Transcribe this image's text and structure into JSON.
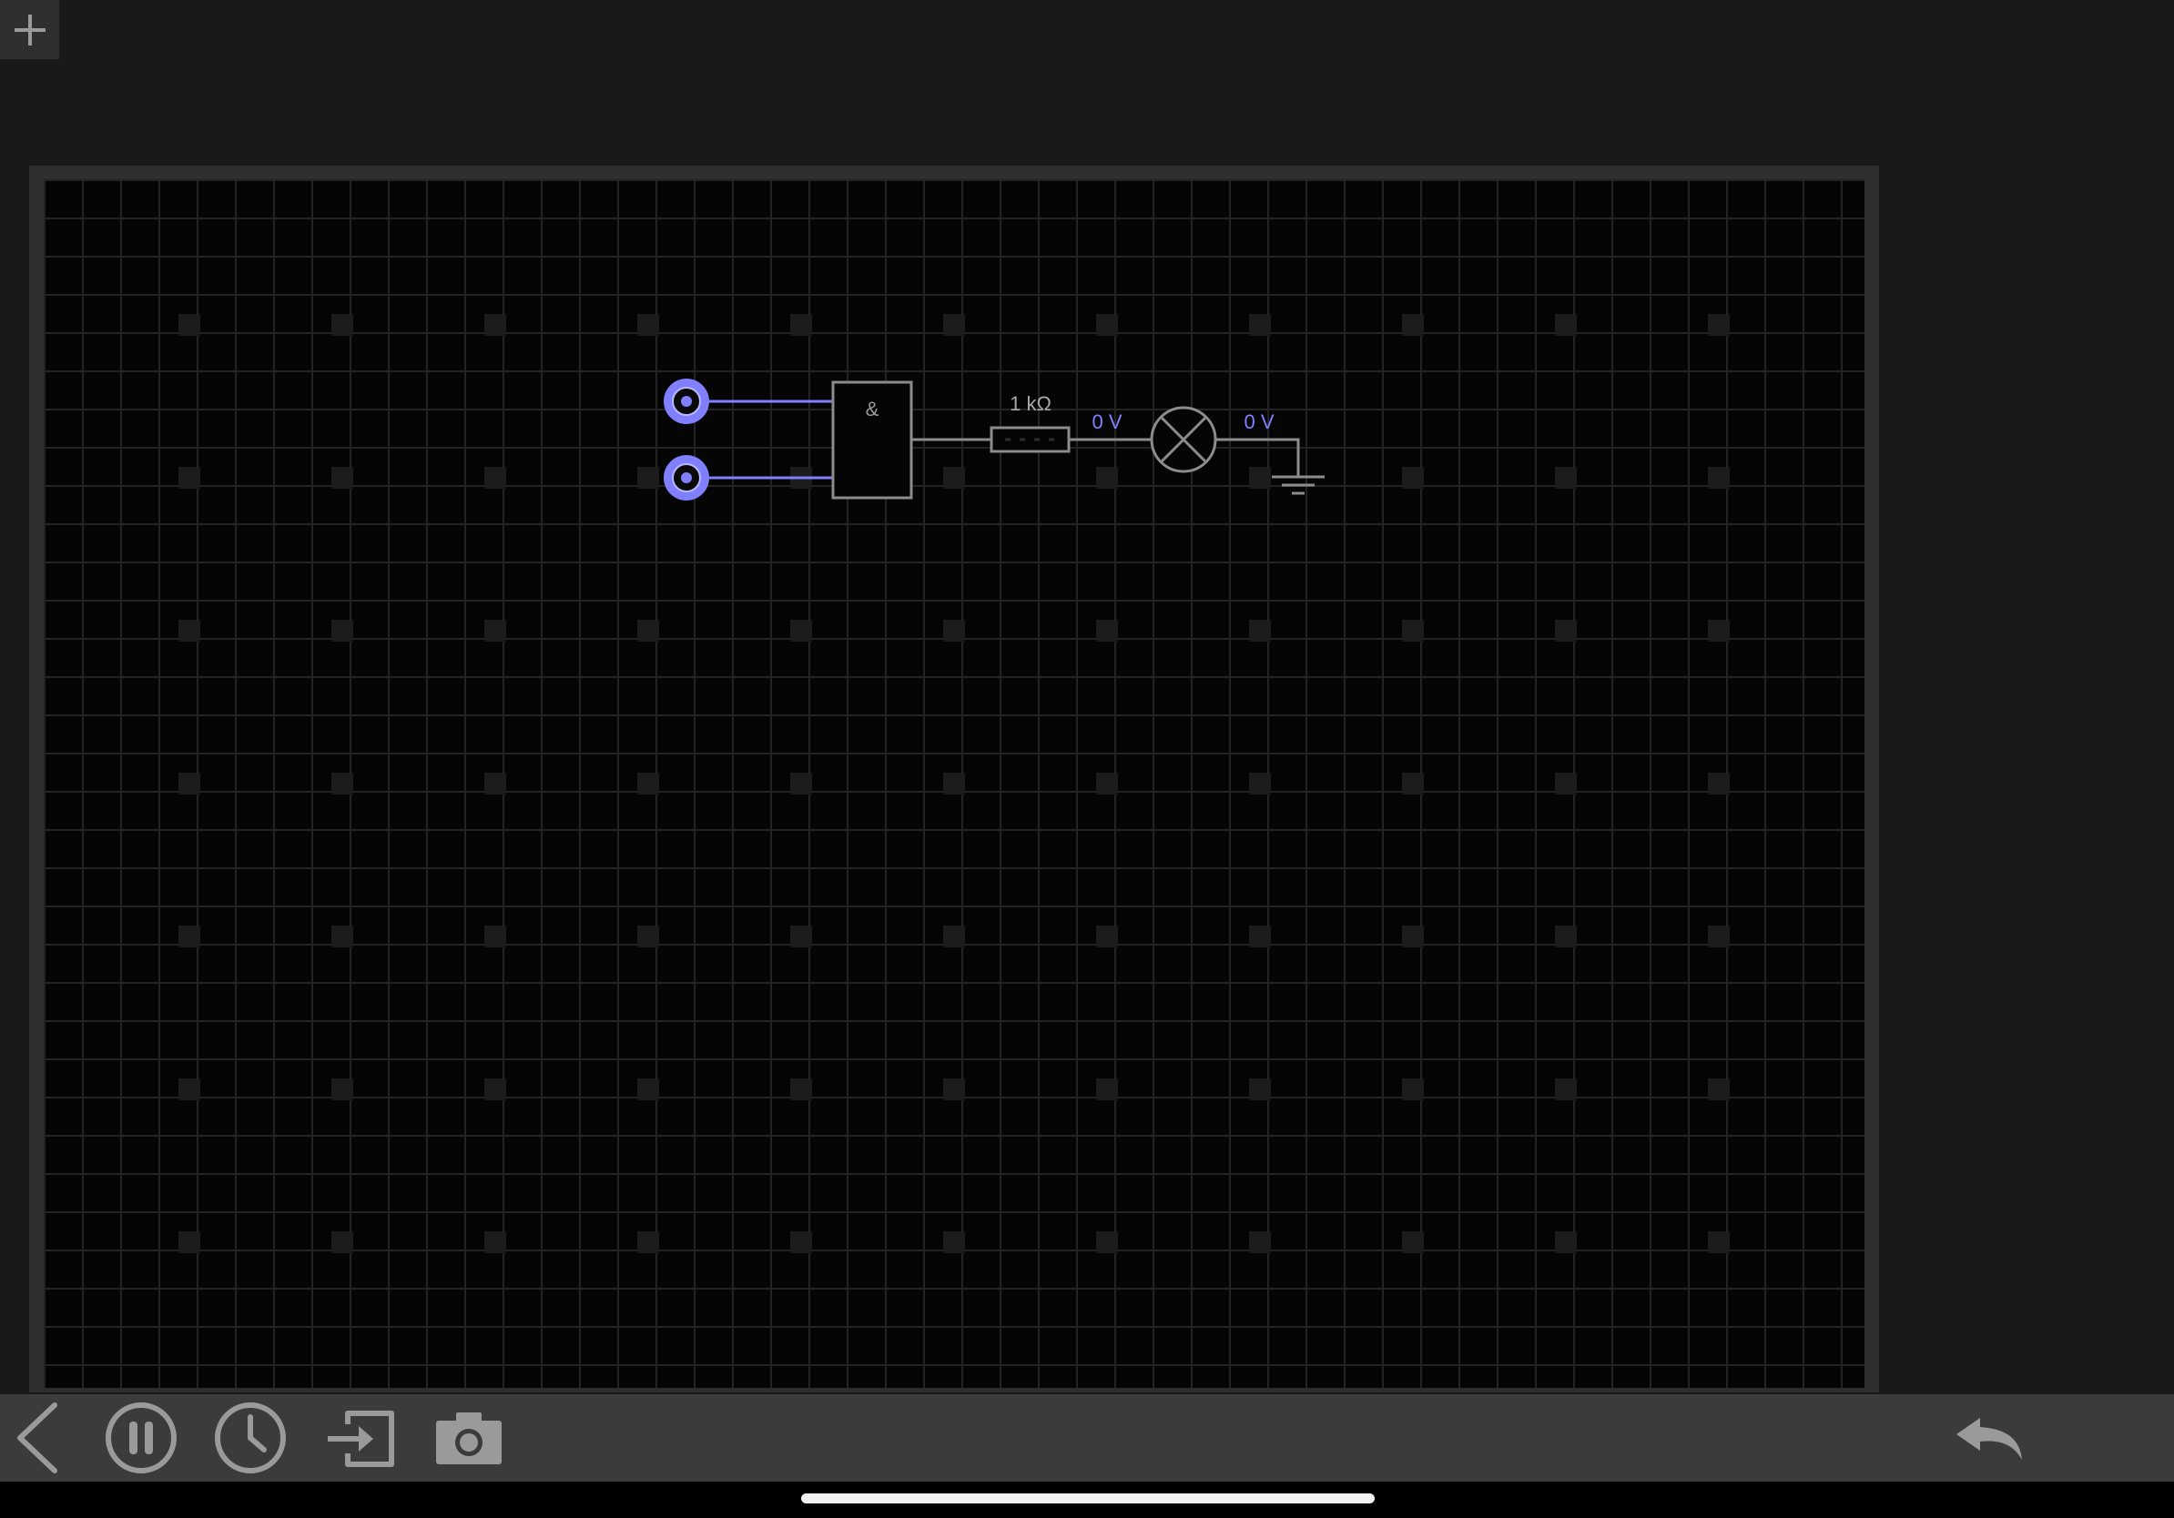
{
  "toolbar_top": {
    "add_icon": "plus-icon"
  },
  "circuit": {
    "gate_symbol": "&",
    "resistor_label": "1 kΩ",
    "voltage_before_lamp": "0 V",
    "voltage_after_lamp": "0 V",
    "components": [
      "input-toggle",
      "input-toggle",
      "and-gate",
      "resistor",
      "lamp",
      "ground"
    ]
  },
  "toolbar_bottom": {
    "buttons": [
      {
        "name": "back",
        "icon": "chevron-left-icon"
      },
      {
        "name": "pause",
        "icon": "pause-circle-icon"
      },
      {
        "name": "time",
        "icon": "clock-icon"
      },
      {
        "name": "export",
        "icon": "export-icon"
      },
      {
        "name": "screenshot",
        "icon": "camera-icon"
      },
      {
        "name": "undo",
        "icon": "undo-arrow-icon"
      }
    ]
  },
  "colors": {
    "accent": "#8080ff",
    "wire_neutral": "#8c8c8c",
    "background": "#050505",
    "frame": "#2e2e2e",
    "toolbar": "#3b3b3b"
  }
}
